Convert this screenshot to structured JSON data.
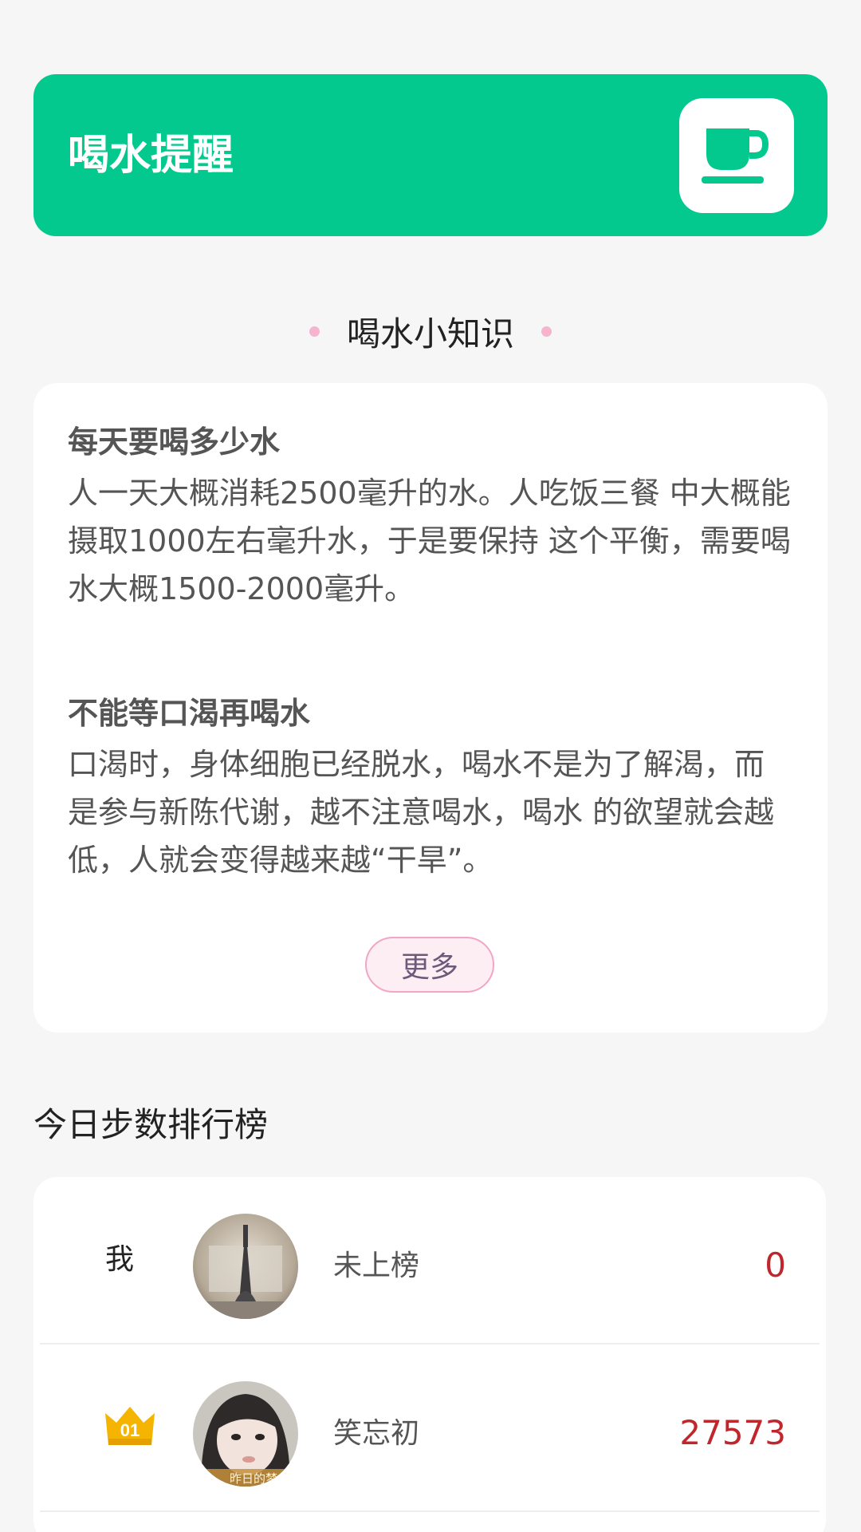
{
  "header": {
    "title": "喝水提醒",
    "icon": "coffee-cup-icon",
    "color": "#04c98e"
  },
  "tips_section": {
    "heading": "喝水小知识",
    "tips": [
      {
        "title": "每天要喝多少水",
        "body": "人一天大概消耗2500毫升的水。人吃饭三餐 中大概能摄取1000左右毫升水，于是要保持 这个平衡，需要喝水大概1500-2000毫升。"
      },
      {
        "title": "不能等口渴再喝水",
        "body": "口渴时，身体细胞已经脱水，喝水不是为了解渴，而是参与新陈代谢，越不注意喝水，喝水 的欲望就会越低，人就会变得越来越“干旱”。"
      }
    ],
    "more_label": "更多"
  },
  "leaderboard": {
    "title": "今日步数排行榜",
    "rows": [
      {
        "rank": "我",
        "name": "未上榜",
        "steps": "0"
      },
      {
        "rank": "01",
        "name": "笑忘初",
        "steps": "27573",
        "avatar_caption": "昨日的梦"
      }
    ],
    "accent_color": "#c0262c"
  }
}
